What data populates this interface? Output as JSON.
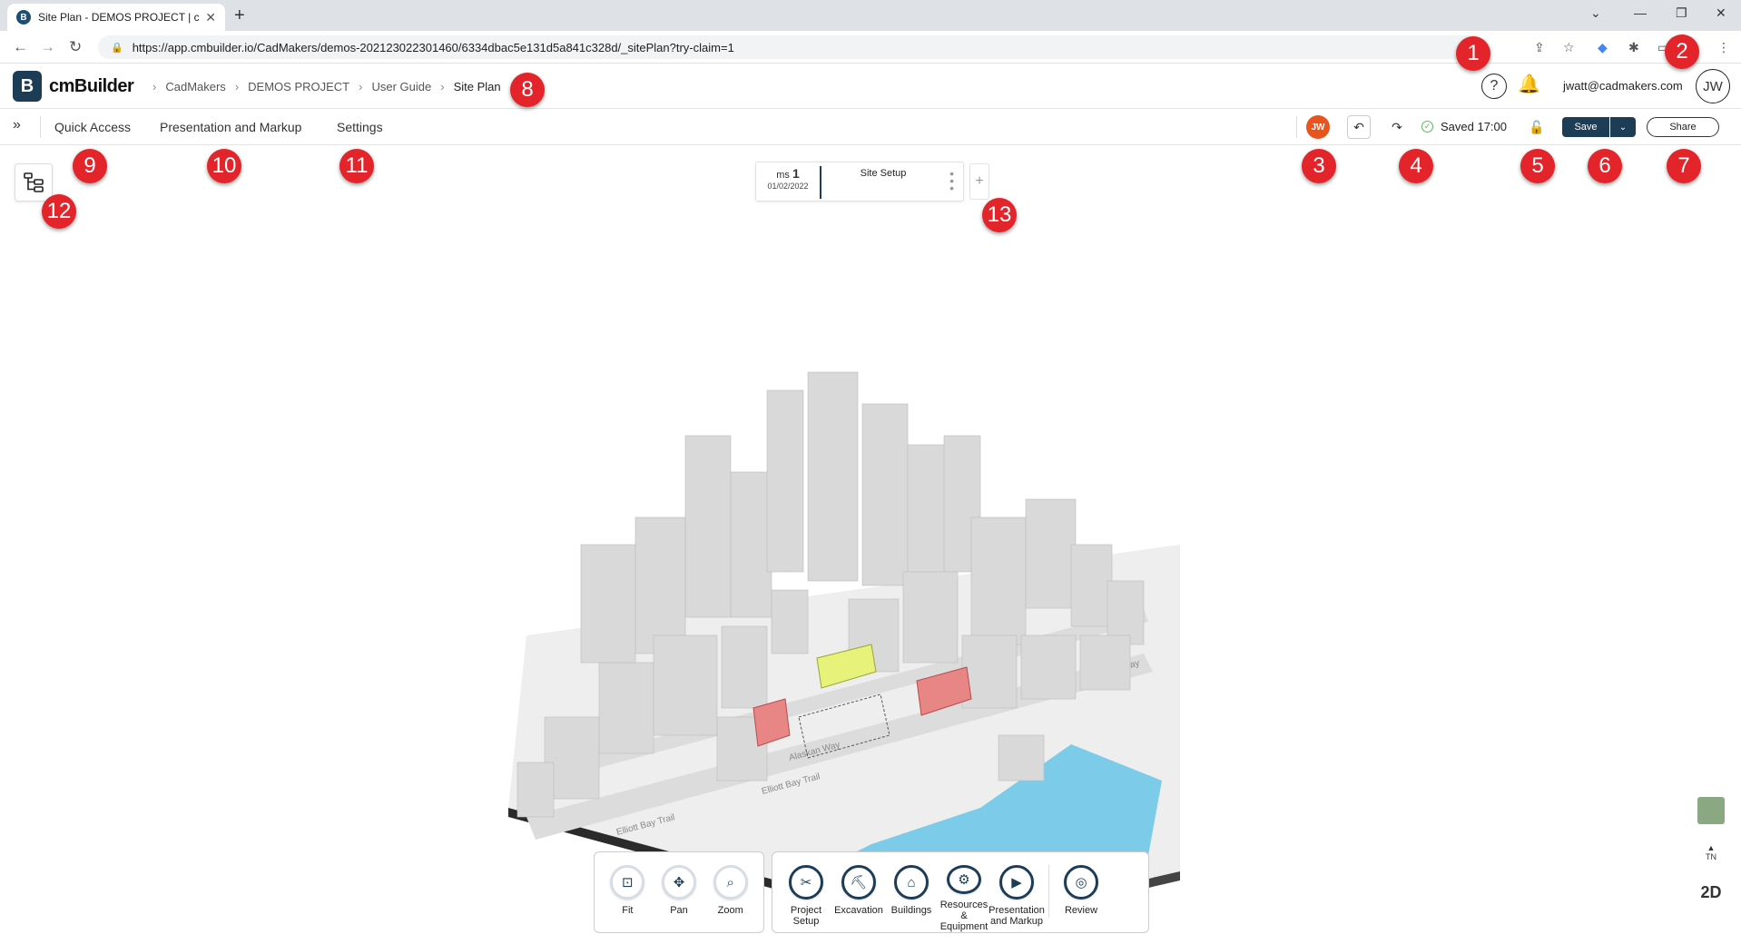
{
  "browser": {
    "tab_title": "Site Plan - DEMOS PROJECT | cm",
    "url": "https://app.cmbuilder.io/CadMakers/demos-202123022301460/6334dbac5e131d5a841c328d/_sitePlan?try-claim=1"
  },
  "header": {
    "brand": "cmBuilder",
    "logo_letter": "B",
    "breadcrumbs": [
      "CadMakers",
      "DEMOS PROJECT",
      "User Guide",
      "Site Plan"
    ],
    "user_email": "jwatt@cadmakers.com",
    "avatar_initials": "JW"
  },
  "toolbar": {
    "menu": [
      "Quick Access",
      "Presentation and Markup",
      "Settings"
    ],
    "user_badge": "JW",
    "saved_text": "Saved 17:00",
    "save_label": "Save",
    "share_label": "Share"
  },
  "milestone": {
    "ms_label": "ms",
    "ms_number": "1",
    "date": "01/02/2022",
    "title": "Site Setup"
  },
  "controls": {
    "view": [
      {
        "label": "Fit",
        "icon": "fit-icon"
      },
      {
        "label": "Pan",
        "icon": "pan-icon"
      },
      {
        "label": "Zoom",
        "icon": "zoom-icon"
      }
    ],
    "modes": [
      {
        "label": "Project Setup",
        "icon": "tools-icon"
      },
      {
        "label": "Excavation",
        "icon": "excavation-icon"
      },
      {
        "label": "Buildings",
        "icon": "buildings-icon"
      },
      {
        "label": "Resources & Equipment",
        "icon": "resources-icon"
      },
      {
        "label": "Presentation and Markup",
        "icon": "presentation-icon"
      }
    ],
    "review": {
      "label": "Review",
      "icon": "review-icon"
    }
  },
  "side": {
    "north_label": "TN",
    "view_mode": "2D"
  },
  "map_labels": [
    "Alaskan Way",
    "Alaskan Way",
    "Elliott Bay Trail",
    "Elliott Bay Trail"
  ],
  "markers": [
    "1",
    "2",
    "3",
    "4",
    "5",
    "6",
    "7",
    "8",
    "9",
    "10",
    "11",
    "12",
    "13"
  ],
  "colors": {
    "brand": "#1d3d57",
    "marker": "#e3242b",
    "user_badge": "#e8541e",
    "highlight_building": "#e6f27a",
    "red_building": "#e88585",
    "water": "#7ccbe8"
  }
}
